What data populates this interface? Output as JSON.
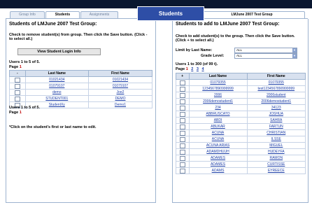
{
  "callout": "Students",
  "tabs": {
    "group_info": "Group Info",
    "students": "Students",
    "assignments": "Assignments",
    "right_title": "LMJune 2007 Test Group"
  },
  "left": {
    "heading": "Students of LMJune 2007 Test Group:",
    "instructions": "Check to remove student(s) from group. Then click the Save button. (Click - to select all.)",
    "button": "View Student Login Info",
    "users_label": "Users 1 to 5 of 5.",
    "page_label": "Page",
    "page_current": "1",
    "columns": [
      "-",
      "Last Name",
      "First Name"
    ],
    "rows": [
      {
        "last": "01021434",
        "first": "01021434"
      },
      {
        "last": "01079107",
        "first": "01079107"
      },
      {
        "last": "demo",
        "first": "Joe2"
      },
      {
        "last": "STUDENT001",
        "first": "DEMO"
      },
      {
        "last": "StudentXy",
        "first": "Demo1"
      }
    ],
    "users_label_bottom": "Users 1 to 5 of 5.",
    "note": "*Click on the student's first or last name to edit."
  },
  "right": {
    "heading": "Students to add to LMJune 2007 Test Group:",
    "instructions": "Check to add student(s) to the group. Then click the Save button. (Click + to select all.)",
    "limit_label": "Limit by Last Name:",
    "limit_value": "ALL",
    "grade_label": "Grade Level:",
    "grade_value": "ALL",
    "users_label": "Users 1 to 300 (of 99 t).",
    "page_label": "Page",
    "pages": [
      "1",
      "2",
      "3",
      "4"
    ],
    "columns": [
      "+",
      "Last Name",
      "First Name"
    ],
    "rows": [
      {
        "last": "01079355",
        "first": "01079355"
      },
      {
        "last": "1234567890999999",
        "first": "test1234567890999999"
      },
      {
        "last": "2006",
        "first": "2006student"
      },
      {
        "last": "2006demostudent1",
        "first": "2006demostudent1"
      },
      {
        "last": "234",
        "first": "34123"
      },
      {
        "last": "ABBRUSCATO",
        "first": "JOSHUA"
      },
      {
        "last": "ABDI",
        "first": "SAHRA"
      },
      {
        "last": "ABUKAR",
        "first": "FARTUN"
      },
      {
        "last": "ACUNA",
        "first": "CHRISTIAN"
      },
      {
        "last": "ACUNA",
        "first": "ILSSE"
      },
      {
        "last": "ACUNA ARIAS",
        "first": "MIGUEL"
      },
      {
        "last": "ADAMDHUUH",
        "first": "HUDEYFA"
      },
      {
        "last": "ADAMES",
        "first": "RAMON"
      },
      {
        "last": "ADAMES",
        "first": "CURTISSE"
      },
      {
        "last": "ADAMS",
        "first": "EYREECE"
      }
    ]
  },
  "colors": {
    "topbar": "#0a1730",
    "callout": "#2e4ea6",
    "header": "#d8e1ef",
    "link": "#1d3fa8",
    "accent_red": "#c00000"
  }
}
